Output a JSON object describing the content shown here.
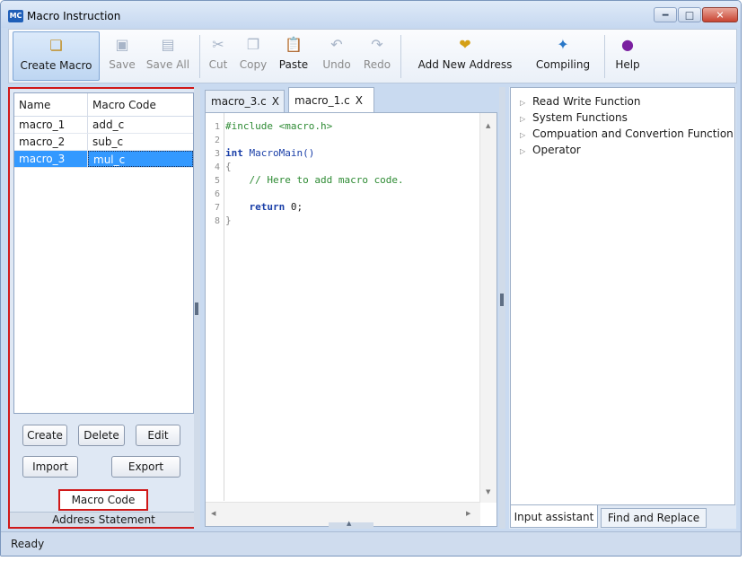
{
  "window": {
    "app_icon": "MC",
    "title": "Macro Instruction"
  },
  "toolbar": {
    "create_macro": "Create Macro",
    "save": "Save",
    "save_all": "Save All",
    "cut": "Cut",
    "copy": "Copy",
    "paste": "Paste",
    "undo": "Undo",
    "redo": "Redo",
    "add_new_address": "Add New Address",
    "compiling": "Compiling",
    "help": "Help"
  },
  "macro_list": {
    "headers": [
      "Name",
      "Macro Code"
    ],
    "rows": [
      {
        "name": "macro_1",
        "code": "add_c",
        "selected": false
      },
      {
        "name": "macro_2",
        "code": "sub_c",
        "selected": false
      },
      {
        "name": "macro_3",
        "code": "mul_c",
        "selected": true
      }
    ]
  },
  "left_buttons": {
    "create": "Create",
    "delete": "Delete",
    "edit": "Edit",
    "import": "Import",
    "export": "Export"
  },
  "left_tabs": {
    "macro_code": "Macro Code",
    "address_statement": "Address Statement"
  },
  "editor": {
    "tabs": [
      {
        "label": "macro_3.c",
        "close": "X"
      },
      {
        "label": "macro_1.c",
        "close": "X",
        "active": true
      }
    ],
    "line_numbers": [
      "1",
      "2",
      "3",
      "4",
      "5",
      "6",
      "7",
      "8"
    ],
    "code": {
      "include": "#include <macro.h>",
      "int_kw": "int",
      "main_sig": " MacroMain()",
      "open_brace": "{",
      "comment": "    // Here to add macro code.",
      "return_kw": "    return",
      "return_val": " 0;",
      "close_brace": "}"
    }
  },
  "assistant": {
    "tree": [
      "Read Write Function",
      "System Functions",
      "Compuation and Convertion Function",
      "Operator"
    ],
    "tabs": {
      "input_assistant": "Input assistant",
      "find_replace": "Find and Replace"
    }
  },
  "status": {
    "text": "Ready"
  },
  "colors": {
    "selection": "#3399ff",
    "highlight_box": "#d01818",
    "keyword": "#1a3fa8",
    "comment": "#2e8b34"
  }
}
